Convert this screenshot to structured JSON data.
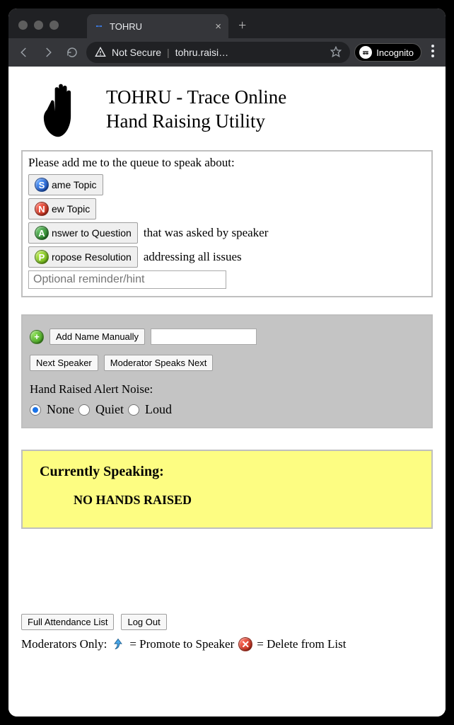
{
  "browser": {
    "tab_title": "TOHRU",
    "address_security_label": "Not Secure",
    "address_url": "tohru.raisi…",
    "incognito_label": "Incognito"
  },
  "header": {
    "title_line1": "TOHRU - Trace Online",
    "title_line2": "Hand Raising Utility"
  },
  "queue_panel": {
    "prompt": "Please add me to the queue to speak about:",
    "options": [
      {
        "badge_letter": "S",
        "badge_color": "blue",
        "button_label": "ame Topic",
        "suffix": ""
      },
      {
        "badge_letter": "N",
        "badge_color": "red",
        "button_label": "ew Topic",
        "suffix": ""
      },
      {
        "badge_letter": "A",
        "badge_color": "darkgreen",
        "button_label": "nswer to Question",
        "suffix": "that was asked by speaker"
      },
      {
        "badge_letter": "P",
        "badge_color": "limegreen",
        "button_label": "ropose Resolution",
        "suffix": "addressing all issues"
      }
    ],
    "hint_placeholder": "Optional reminder/hint"
  },
  "moderator_panel": {
    "add_name_label": "Add Name Manually",
    "next_speaker_label": "Next Speaker",
    "moderator_speaks_label": "Moderator Speaks Next",
    "alert_label": "Hand Raised Alert Noise:",
    "alert_options": [
      "None",
      "Quiet",
      "Loud"
    ],
    "alert_selected_index": 0
  },
  "speaking_panel": {
    "heading": "Currently Speaking:",
    "status": "NO HANDS RAISED"
  },
  "footer": {
    "attendance_label": "Full Attendance List",
    "logout_label": "Log Out",
    "legend_prefix": "Moderators Only:",
    "legend_promote": "= Promote to Speaker",
    "legend_delete": "= Delete from List"
  }
}
